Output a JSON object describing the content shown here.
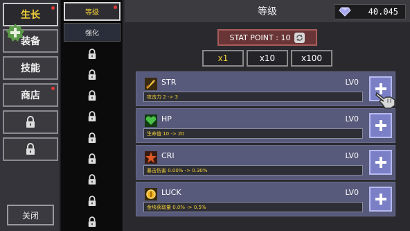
{
  "left_menu": {
    "tabs": [
      {
        "label": "生长",
        "active": true,
        "dot": true
      },
      {
        "label": "装备",
        "active": false,
        "dot": false
      },
      {
        "label": "技能",
        "active": false,
        "dot": false
      },
      {
        "label": "商店",
        "active": false,
        "dot": true
      }
    ],
    "locked_slots": 2,
    "close_label": "关闭"
  },
  "sub_menu": {
    "tabs": [
      {
        "label": "等级",
        "active": true,
        "dot": true
      },
      {
        "label": "强化",
        "active": false,
        "dot": false
      }
    ],
    "locked_slots": 9
  },
  "header": {
    "title": "等级",
    "gems": "40.045"
  },
  "stat_point": {
    "label": "STAT POINT : 10"
  },
  "multipliers": [
    {
      "label": "x1",
      "active": true
    },
    {
      "label": "x10",
      "active": false
    },
    {
      "label": "x100",
      "active": false
    }
  ],
  "stats": [
    {
      "name": "STR",
      "level": "LV0",
      "desc": "攻击力 2 -> 3",
      "icon": "sword-icon",
      "color": "#e8b430"
    },
    {
      "name": "HP",
      "level": "LV0",
      "desc": "生命值 10 -> 20",
      "icon": "heart-icon",
      "color": "#48c048"
    },
    {
      "name": "CRI",
      "level": "LV0",
      "desc": "暴击伤害 0.00% -> 0.30%",
      "icon": "critical-icon",
      "color": "#e05a28"
    },
    {
      "name": "LUCK",
      "level": "LV0",
      "desc": "金块获取量 0.0% -> 0.5%",
      "icon": "luck-icon",
      "color": "#f0b020"
    }
  ],
  "colors": {
    "accent_yellow": "#f5d23a",
    "add_button": "#7b7fc6",
    "stat_point_bg": "#6a3536"
  }
}
